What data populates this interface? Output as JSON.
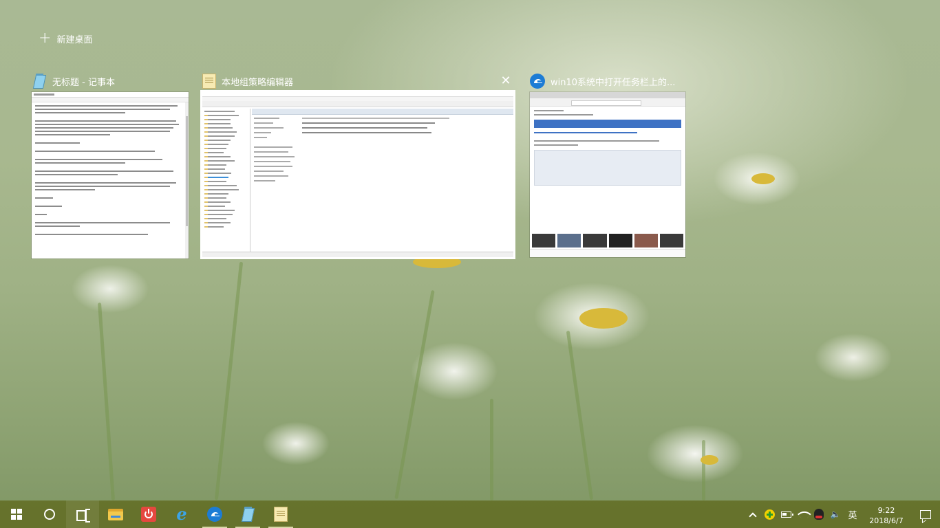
{
  "desktop": {
    "new_desktop_label": "新建桌面"
  },
  "windows": [
    {
      "title": "无标题 - 记事本",
      "icon": "notepad-icon",
      "app": "notepad"
    },
    {
      "title": "本地组策略编辑器",
      "icon": "gpedit-icon",
      "app": "gpedit",
      "selected": true
    },
    {
      "title": "win10系统中打开任务栏上的...",
      "icon": "edge-icon",
      "app": "edge"
    }
  ],
  "taskbar": {
    "items": [
      "start-icon",
      "cortana-icon",
      "task-view-icon",
      "file-explorer-icon",
      "power-app-icon",
      "internet-explorer-icon",
      "edge-icon",
      "notepad-icon",
      "gpedit-icon"
    ],
    "tray": {
      "ime_label": "英",
      "time": "9:22",
      "date": "2018/6/7"
    }
  },
  "colors": {
    "taskbar": "#5f6a20",
    "selection_border": "#ffffff",
    "edge_blue": "#1c7cd5"
  }
}
